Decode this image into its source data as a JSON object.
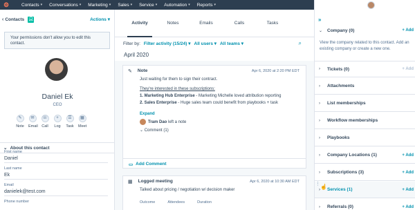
{
  "nav": {
    "logo": "⚙",
    "items": [
      "Contacts",
      "Conversations",
      "Marketing",
      "Sales",
      "Service",
      "Automation",
      "Reports"
    ],
    "icons": [
      "search-icon",
      "marketplace-icon",
      "settings-icon",
      "notifications-icon"
    ]
  },
  "left": {
    "back_label": "Contacts",
    "actions_label": "Actions",
    "permission_text": "Your permissions don't allow you to edit this contact.",
    "name": "Daniel Ek",
    "job_title": "CEO",
    "activity_buttons": [
      "Note",
      "Email",
      "Call",
      "Log",
      "Task",
      "Meet"
    ],
    "about_title": "About this contact",
    "fields": [
      {
        "label": "First name",
        "value": "Daniel"
      },
      {
        "label": "Last name",
        "value": "Ek"
      },
      {
        "label": "Email",
        "value": "danielek@test.com"
      },
      {
        "label": "Phone number",
        "value": ""
      }
    ]
  },
  "middle": {
    "tabs": [
      "Activity",
      "Notes",
      "Emails",
      "Calls",
      "Tasks"
    ],
    "filter_by": "Filter by:",
    "filter_activity": "Filter activity (15/24)",
    "filter_users": "All users",
    "filter_teams": "All teams",
    "month": "April 2020",
    "note_card": {
      "title": "Note",
      "date": "Apr 6, 2020 at 2:20 PM EDT",
      "line1": "Just waiting for them to sign their contract.",
      "line2": "They're interested in these subscriptions:",
      "item1_bold": "1. Marketing Hub Enterprise",
      "item1_rest": " - Marketing Michelle loved attribution reporting",
      "item2_bold": "2. Sales Enterprise",
      "item2_rest": " - Huge sales team could benefit from playbooks + task",
      "expand": "Expand",
      "author": "Tram Dao",
      "author_action": "left a note",
      "comment": "Comment (1)",
      "add_comment": "Add Comment"
    },
    "meeting_card": {
      "title": "Logged meeting",
      "date": "Apr 6, 2020 at 10:30 AM EDT",
      "text": "Talked about pricing / negotiation w/ decision maker",
      "cols": [
        "Outcome",
        "Attendees",
        "Duration"
      ]
    }
  },
  "right": {
    "company": {
      "title": "Company (0)",
      "add": "+ Add"
    },
    "company_text": "View the company related to this contact. Add an existing company or create a new one.",
    "sections": [
      {
        "title": "Tickets (0)",
        "add": "+ Add",
        "muted": true
      },
      {
        "title": "Attachments",
        "add": ""
      },
      {
        "title": "List memberships",
        "add": ""
      },
      {
        "title": "Workflow memberships",
        "add": ""
      },
      {
        "title": "Playbooks",
        "add": ""
      },
      {
        "title": "Company Locations (1)",
        "add": "+ Add"
      },
      {
        "title": "Subscriptions (3)",
        "add": "+ Add"
      },
      {
        "title": "Services (1)",
        "add": "+ Add"
      },
      {
        "title": "Referrals (0)",
        "add": "+ Add"
      }
    ]
  }
}
